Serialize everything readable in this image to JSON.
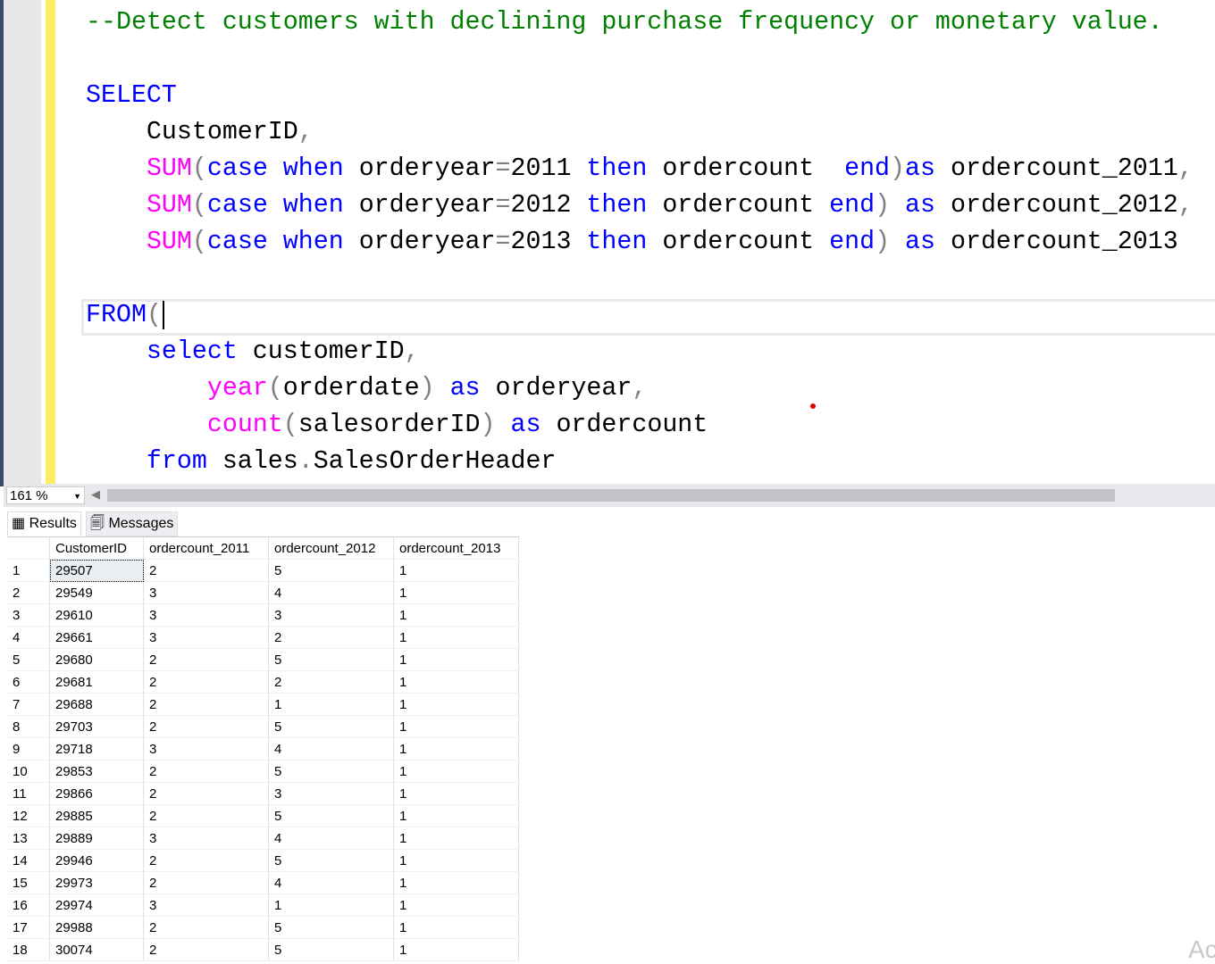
{
  "editor": {
    "lines": [
      {
        "row": 0,
        "tokens": [
          [
            "--Detect customers with declining purchase frequency or monetary value.",
            "comment"
          ]
        ]
      },
      {
        "row": 2,
        "tokens": [
          [
            "SELECT",
            "kw"
          ]
        ]
      },
      {
        "row": 3,
        "tokens": [
          [
            "    CustomerID",
            "id"
          ],
          [
            ",",
            "op"
          ]
        ]
      },
      {
        "row": 4,
        "tokens": [
          [
            "    ",
            "id"
          ],
          [
            "SUM",
            "fn"
          ],
          [
            "(",
            "op"
          ],
          [
            "case when ",
            "kw"
          ],
          [
            "orderyear",
            "id"
          ],
          [
            "=",
            "op"
          ],
          [
            "2011 ",
            "id"
          ],
          [
            "then ",
            "kw"
          ],
          [
            "ordercount  ",
            "id"
          ],
          [
            "end",
            "kw"
          ],
          [
            ")",
            "op"
          ],
          [
            "as ",
            "kw"
          ],
          [
            "ordercount_2011",
            "id"
          ],
          [
            ",",
            "op"
          ]
        ]
      },
      {
        "row": 5,
        "tokens": [
          [
            "    ",
            "id"
          ],
          [
            "SUM",
            "fn"
          ],
          [
            "(",
            "op"
          ],
          [
            "case when ",
            "kw"
          ],
          [
            "orderyear",
            "id"
          ],
          [
            "=",
            "op"
          ],
          [
            "2012 ",
            "id"
          ],
          [
            "then ",
            "kw"
          ],
          [
            "ordercount ",
            "id"
          ],
          [
            "end",
            "kw"
          ],
          [
            ") ",
            "op"
          ],
          [
            "as ",
            "kw"
          ],
          [
            "ordercount_2012",
            "id"
          ],
          [
            ",",
            "op"
          ]
        ]
      },
      {
        "row": 6,
        "tokens": [
          [
            "    ",
            "id"
          ],
          [
            "SUM",
            "fn"
          ],
          [
            "(",
            "op"
          ],
          [
            "case when ",
            "kw"
          ],
          [
            "orderyear",
            "id"
          ],
          [
            "=",
            "op"
          ],
          [
            "2013 ",
            "id"
          ],
          [
            "then ",
            "kw"
          ],
          [
            "ordercount ",
            "id"
          ],
          [
            "end",
            "kw"
          ],
          [
            ") ",
            "op"
          ],
          [
            "as ",
            "kw"
          ],
          [
            "ordercount_2013",
            "id"
          ]
        ]
      },
      {
        "row": 8,
        "tokens": [
          [
            "FROM",
            "kw"
          ],
          [
            "(",
            "op"
          ]
        ],
        "caret": true
      },
      {
        "row": 9,
        "tokens": [
          [
            "    select ",
            "kw"
          ],
          [
            "customerID",
            "id"
          ],
          [
            ",",
            "op"
          ]
        ]
      },
      {
        "row": 10,
        "tokens": [
          [
            "        ",
            "id"
          ],
          [
            "year",
            "fn"
          ],
          [
            "(",
            "op"
          ],
          [
            "orderdate",
            "id"
          ],
          [
            ") ",
            "op"
          ],
          [
            "as ",
            "kw"
          ],
          [
            "orderyear",
            "id"
          ],
          [
            ",",
            "op"
          ]
        ]
      },
      {
        "row": 11,
        "tokens": [
          [
            "        ",
            "id"
          ],
          [
            "count",
            "fn"
          ],
          [
            "(",
            "op"
          ],
          [
            "salesorderID",
            "id"
          ],
          [
            ") ",
            "op"
          ],
          [
            "as ",
            "kw"
          ],
          [
            "ordercount",
            "id"
          ]
        ]
      },
      {
        "row": 12,
        "tokens": [
          [
            "    from ",
            "kw"
          ],
          [
            "sales",
            "id"
          ],
          [
            ".",
            "op"
          ],
          [
            "SalesOrderHeader",
            "id"
          ]
        ]
      }
    ]
  },
  "zoom": {
    "value": "161 %"
  },
  "tabs": {
    "results": "Results",
    "messages": "Messages"
  },
  "grid": {
    "columns": [
      "CustomerID",
      "ordercount_2011",
      "ordercount_2012",
      "ordercount_2013"
    ],
    "rows": [
      [
        "1",
        "29507",
        "2",
        "5",
        "1"
      ],
      [
        "2",
        "29549",
        "3",
        "4",
        "1"
      ],
      [
        "3",
        "29610",
        "3",
        "3",
        "1"
      ],
      [
        "4",
        "29661",
        "3",
        "2",
        "1"
      ],
      [
        "5",
        "29680",
        "2",
        "5",
        "1"
      ],
      [
        "6",
        "29681",
        "2",
        "2",
        "1"
      ],
      [
        "7",
        "29688",
        "2",
        "1",
        "1"
      ],
      [
        "8",
        "29703",
        "2",
        "5",
        "1"
      ],
      [
        "9",
        "29718",
        "3",
        "4",
        "1"
      ],
      [
        "10",
        "29853",
        "2",
        "5",
        "1"
      ],
      [
        "11",
        "29866",
        "2",
        "3",
        "1"
      ],
      [
        "12",
        "29885",
        "2",
        "5",
        "1"
      ],
      [
        "13",
        "29889",
        "3",
        "4",
        "1"
      ],
      [
        "14",
        "29946",
        "2",
        "5",
        "1"
      ],
      [
        "15",
        "29973",
        "2",
        "4",
        "1"
      ],
      [
        "16",
        "29974",
        "3",
        "1",
        "1"
      ],
      [
        "17",
        "29988",
        "2",
        "5",
        "1"
      ],
      [
        "18",
        "30074",
        "2",
        "5",
        "1"
      ]
    ]
  },
  "watermark": "Ac"
}
